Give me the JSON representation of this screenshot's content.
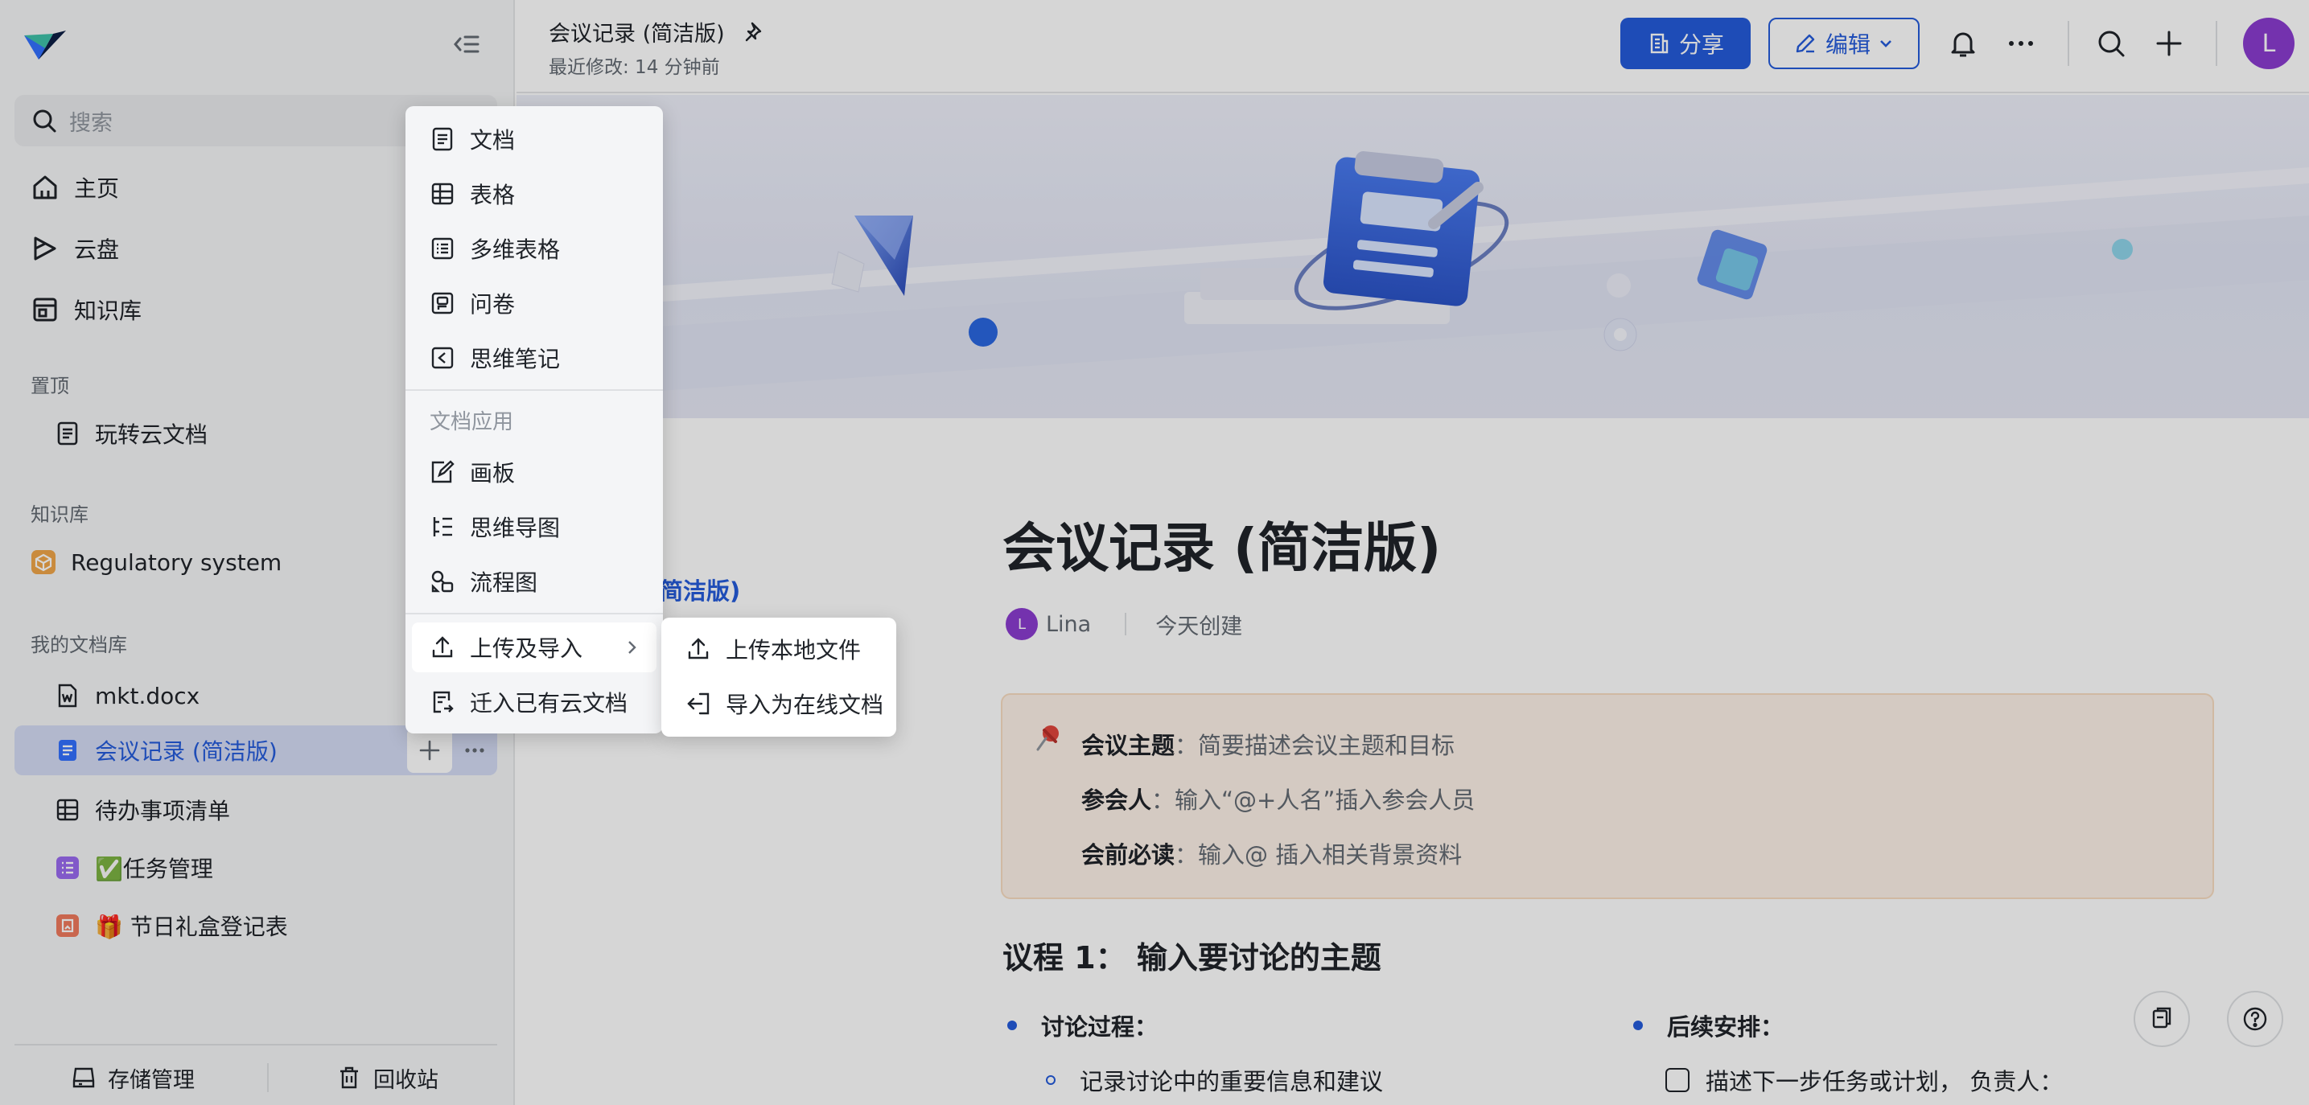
{
  "sidebar": {
    "search_placeholder": "搜索",
    "nav": [
      {
        "label": "主页"
      },
      {
        "label": "云盘"
      },
      {
        "label": "知识库"
      }
    ],
    "pinned_label": "置顶",
    "pinned_items": [
      {
        "label": "玩转云文档"
      }
    ],
    "library_label": "知识库",
    "library_items": [
      {
        "label": "Regulatory system"
      }
    ],
    "my_docs_label": "我的文档库",
    "my_docs": [
      {
        "label": "mkt.docx"
      },
      {
        "label": "会议记录 (简洁版)"
      },
      {
        "label": "待办事项清单"
      },
      {
        "label": "✅任务管理"
      },
      {
        "label": "🎁 节日礼盒登记表"
      }
    ],
    "footer": {
      "storage": "存储管理",
      "trash": "回收站"
    }
  },
  "header": {
    "title": "会议记录 (简洁版)",
    "subtitle": "最近修改: 14 分钟前",
    "share_label": "分享",
    "edit_label": "编辑",
    "avatar_initial": "L"
  },
  "document": {
    "title": "会议记录 (简洁版)",
    "toc_link": "简洁版)",
    "author": "Lina",
    "author_initial": "L",
    "created": "今天创建",
    "callout": {
      "topic_label": "会议主题",
      "topic_text": "：简要描述会议主题和目标",
      "attendees_label": "参会人",
      "attendees_text": "：输入“@+人名”插入参会人员",
      "prereading_label": "会前必读",
      "prereading_text": "：输入@ 插入相关背景资料"
    },
    "agenda_title": "议程 1： 输入要讨论的主题",
    "discussion_label": "讨论过程：",
    "discussion_item": "记录讨论中的重要信息和建议",
    "followup_label": "后续安排：",
    "followup_item": "描述下一步任务或计划， 负责人："
  },
  "create_menu": {
    "items": [
      {
        "label": "文档"
      },
      {
        "label": "表格"
      },
      {
        "label": "多维表格"
      },
      {
        "label": "问卷"
      },
      {
        "label": "思维笔记"
      }
    ],
    "apps_group": "文档应用",
    "apps": [
      {
        "label": "画板"
      },
      {
        "label": "思维导图"
      },
      {
        "label": "流程图"
      }
    ],
    "upload_import": "上传及导入",
    "migrate": "迁入已有云文档"
  },
  "upload_submenu": {
    "items": [
      {
        "label": "上传本地文件"
      },
      {
        "label": "导入为在线文档"
      }
    ]
  },
  "colors": {
    "accent": "#245bdb",
    "avatar": "#8b3cd0",
    "callout_bg": "#fdf1e7",
    "sidebar_bg": "#f5f6f7"
  }
}
